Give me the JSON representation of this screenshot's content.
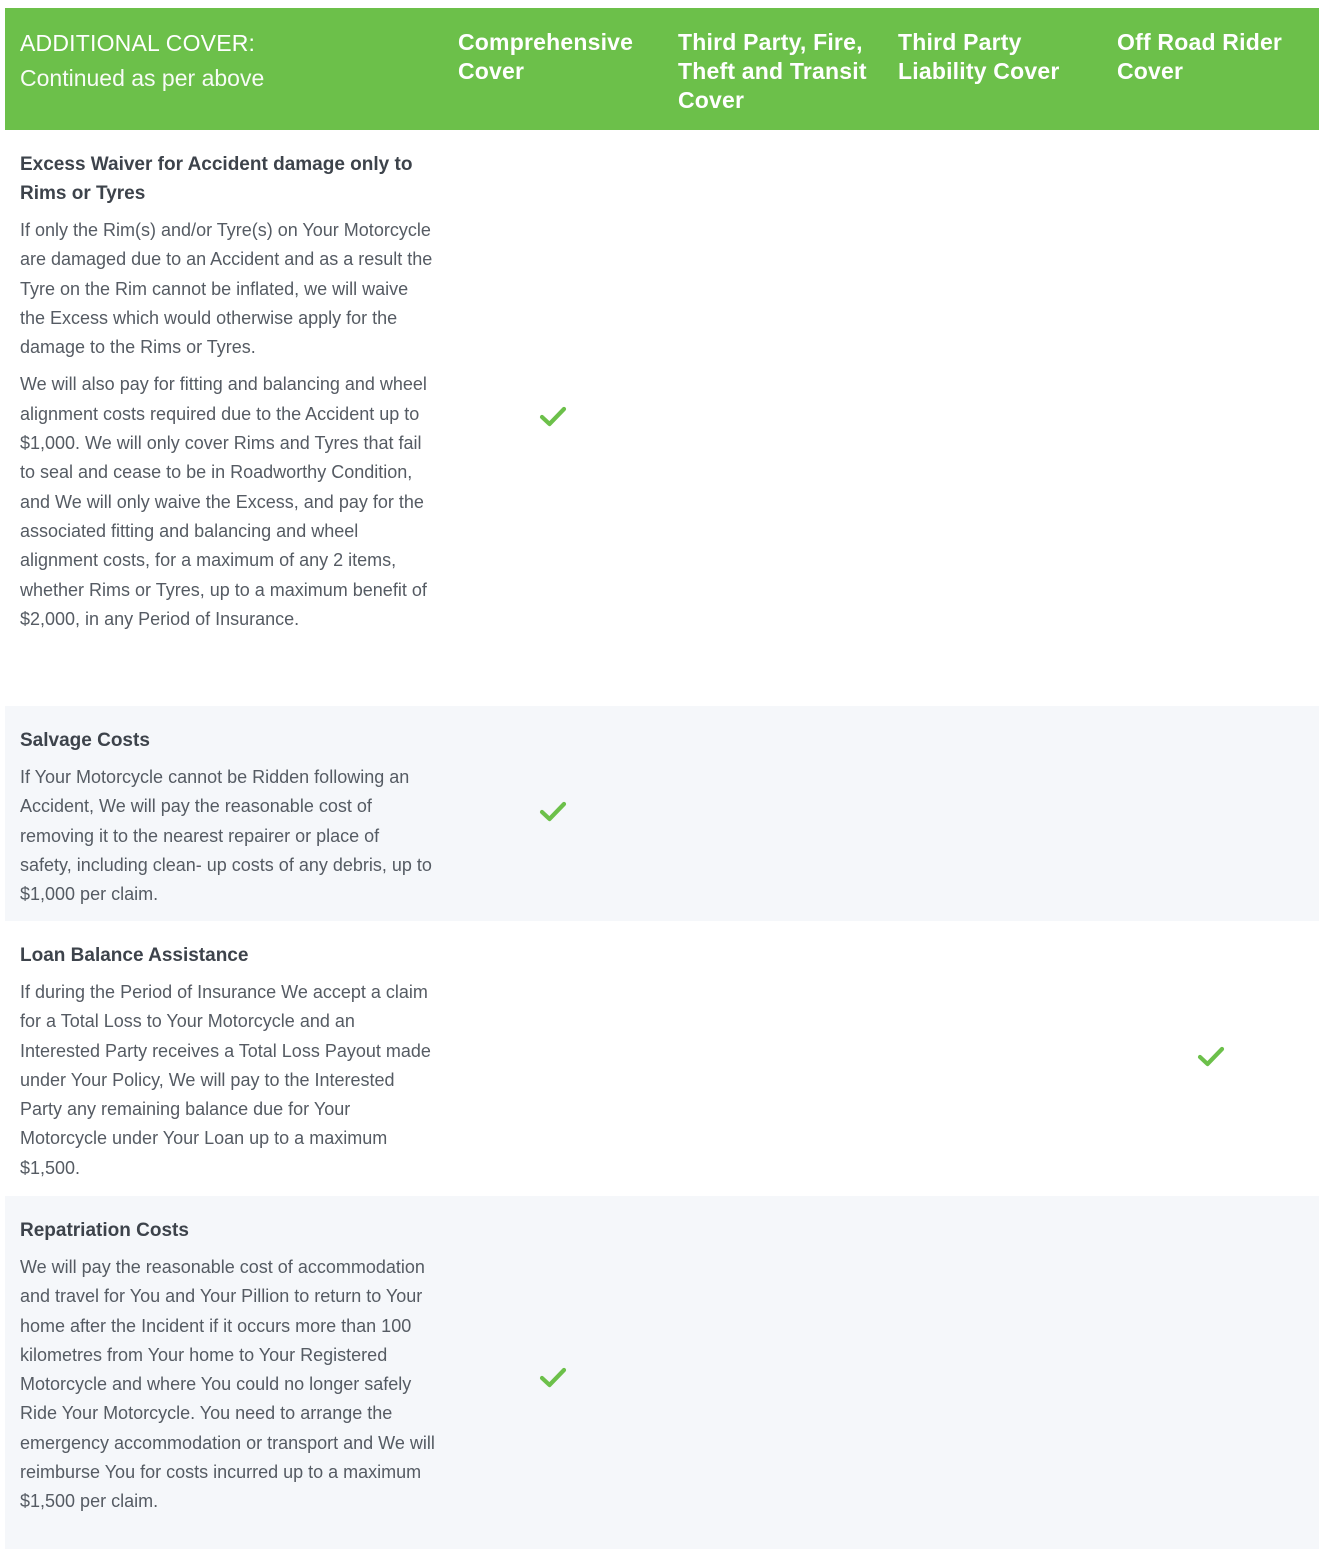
{
  "header": {
    "title": "ADDITIONAL COVER:",
    "subtitle": "Continued as per above",
    "columns": [
      "Comprehensive Cover",
      "Third Party, Fire, Theft and Transit Cover",
      "Third Party Liability Cover",
      "Off Road Rider Cover"
    ]
  },
  "colors": {
    "header_bg": "#6cc04a",
    "check": "#6cc04a",
    "alt_row_bg": "#f5f7fa"
  },
  "rows": [
    {
      "title": "Excess Waiver for Accident damage only to Rims or Tyres",
      "paragraphs": [
        "If only the Rim(s) and/or Tyre(s) on Your Motorcycle are damaged due to an Accident and as a result the Tyre on the Rim cannot be inflated, we will waive the Excess which would otherwise apply for the damage to the Rims or Tyres.",
        "We will also pay for fitting and balancing and wheel alignment costs required due to the Accident up to $1,000. We will only cover Rims and Tyres that fail to seal and cease to be in Roadworthy Condition, and We will only waive the Excess, and pay for the associated fitting and balancing and wheel alignment costs, for a maximum of any 2 items, whether Rims or Tyres, up to a maximum benefit of $2,000, in any Period of Insurance."
      ],
      "covered": [
        true,
        false,
        false,
        false
      ],
      "check_icon": "check-icon"
    },
    {
      "title": "Salvage Costs",
      "paragraphs": [
        "If Your Motorcycle cannot be Ridden following an Accident, We will pay the reasonable cost of removing it to the nearest repairer or place of safety, including clean- up costs of any debris, up to $1,000 per claim."
      ],
      "covered": [
        true,
        false,
        false,
        false
      ],
      "check_icon": "check-icon"
    },
    {
      "title": "Loan Balance Assistance",
      "paragraphs": [
        "If during the Period of Insurance We accept a claim for a Total Loss to Your Motorcycle and an Interested Party receives a Total Loss Payout made under Your Policy, We will pay to the Interested Party any remaining balance due for Your Motorcycle under Your Loan up to a maximum $1,500."
      ],
      "covered": [
        false,
        false,
        false,
        true
      ],
      "check_icon": "check-icon"
    },
    {
      "title": "Repatriation Costs",
      "paragraphs": [
        "We will pay the reasonable cost of accommodation and travel for You and Your Pillion to return to Your home after the Incident if it occurs more than 100 kilometres from Your home to Your Registered Motorcycle and where You could no longer safely Ride Your Motorcycle. You need to arrange the emergency accommodation or transport and We will reimburse You for costs incurred up to a maximum $1,500 per claim."
      ],
      "covered": [
        true,
        false,
        false,
        false
      ],
      "check_icon": "check-icon"
    }
  ]
}
